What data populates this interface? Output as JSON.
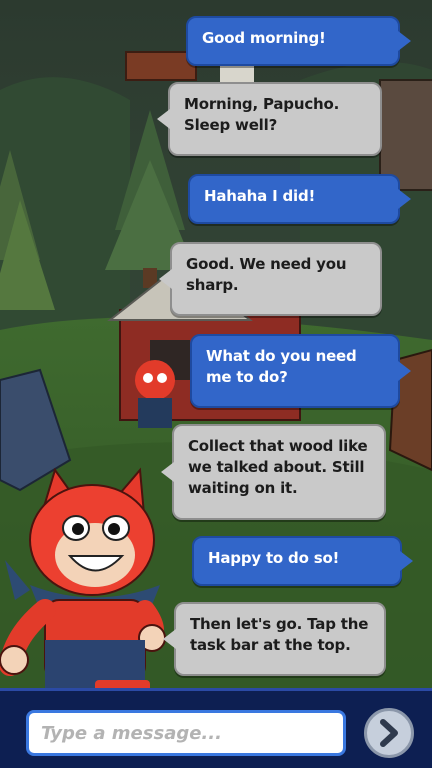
{
  "chat": {
    "messages": [
      {
        "sender": "player",
        "text": "Good morning!"
      },
      {
        "sender": "npc",
        "text": "Morning, Papucho. Sleep well?"
      },
      {
        "sender": "player",
        "text": "Hahaha I did!"
      },
      {
        "sender": "npc",
        "text": "Good. We need you sharp."
      },
      {
        "sender": "player",
        "text": "What do you need me to do?"
      },
      {
        "sender": "npc",
        "text": "Collect that wood like we talked about. Still waiting on it."
      },
      {
        "sender": "player",
        "text": "Happy to do so!"
      },
      {
        "sender": "npc",
        "text": "Then let's go. Tap the task bar at the top."
      }
    ]
  },
  "input": {
    "placeholder": "Type a message..."
  },
  "icons": {
    "send": "chevron-right-icon"
  },
  "colors": {
    "player_bubble": "#3266c9",
    "npc_bubble": "#c9c9c9",
    "input_bar": "#0d1f52",
    "input_border": "#3a78e0"
  }
}
